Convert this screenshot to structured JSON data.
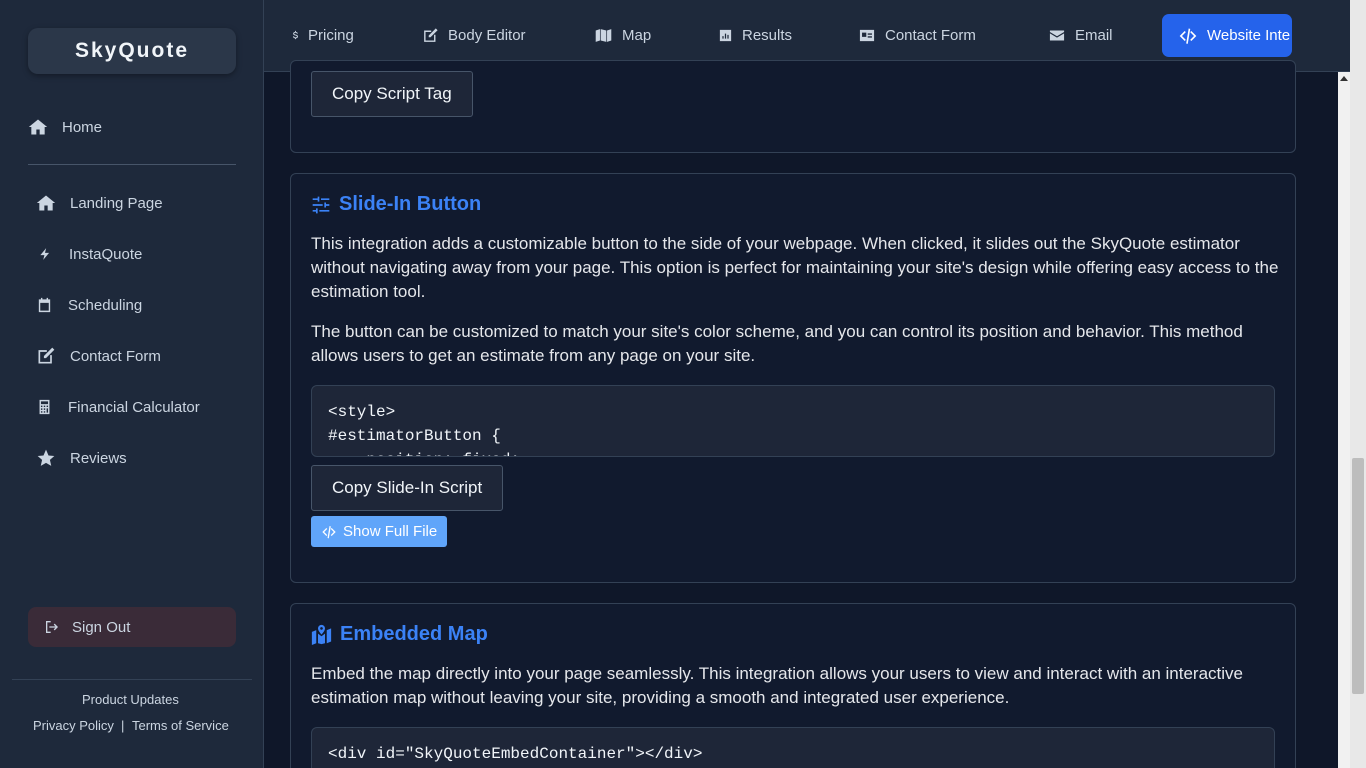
{
  "brand": "SkyQuote",
  "sidebar": {
    "home": "Home",
    "items": [
      {
        "label": "Landing Page",
        "icon": "home-icon"
      },
      {
        "label": "InstaQuote",
        "icon": "bolt-icon"
      },
      {
        "label": "Scheduling",
        "icon": "calendar-icon"
      },
      {
        "label": "Contact Form",
        "icon": "edit-icon"
      },
      {
        "label": "Financial Calculator",
        "icon": "calculator-icon"
      },
      {
        "label": "Reviews",
        "icon": "star-icon"
      }
    ],
    "sign_out": "Sign Out",
    "footer": {
      "product_updates": "Product Updates",
      "privacy": "Privacy Policy",
      "separator": "|",
      "terms": "Terms of Service"
    }
  },
  "topnav": {
    "tabs": [
      {
        "label": "Pricing",
        "icon": "dollar-icon"
      },
      {
        "label": "Body Editor",
        "icon": "edit-icon"
      },
      {
        "label": "Map",
        "icon": "map-icon"
      },
      {
        "label": "Results",
        "icon": "chart-icon"
      },
      {
        "label": "Contact Form",
        "icon": "id-card-icon"
      },
      {
        "label": "Email",
        "icon": "envelope-icon"
      },
      {
        "label": "Website Inte",
        "icon": "code-icon",
        "active": true
      }
    ]
  },
  "sections": {
    "script_tag": {
      "copy_label": "Copy Script Tag"
    },
    "slide_in": {
      "title": "Slide-In Button",
      "para1": "This integration adds a customizable button to the side of your webpage. When clicked, it slides out the SkyQuote estimator without navigating away from your page. This option is perfect for maintaining your site's design while offering easy access to the estimation tool.",
      "para2": "The button can be customized to match your site's color scheme, and you can control its position and behavior. This method allows users to get an estimate from any page on your site.",
      "code": "<style>\n#estimatorButton {\n    position: fixed;",
      "copy_label": "Copy Slide-In Script",
      "show_full_label": "Show Full File"
    },
    "embedded_map": {
      "title": "Embedded Map",
      "para1": "Embed the map directly into your page seamlessly. This integration allows your users to view and interact with an interactive estimation map without leaving your site, providing a smooth and integrated user experience.",
      "code": "<div id=\"SkyQuoteEmbedContainer\"></div>"
    }
  },
  "colors": {
    "accent": "#3b82f6",
    "active_tab": "#2563eb",
    "background": "#0f1729",
    "sidebar": "#1e293b"
  }
}
